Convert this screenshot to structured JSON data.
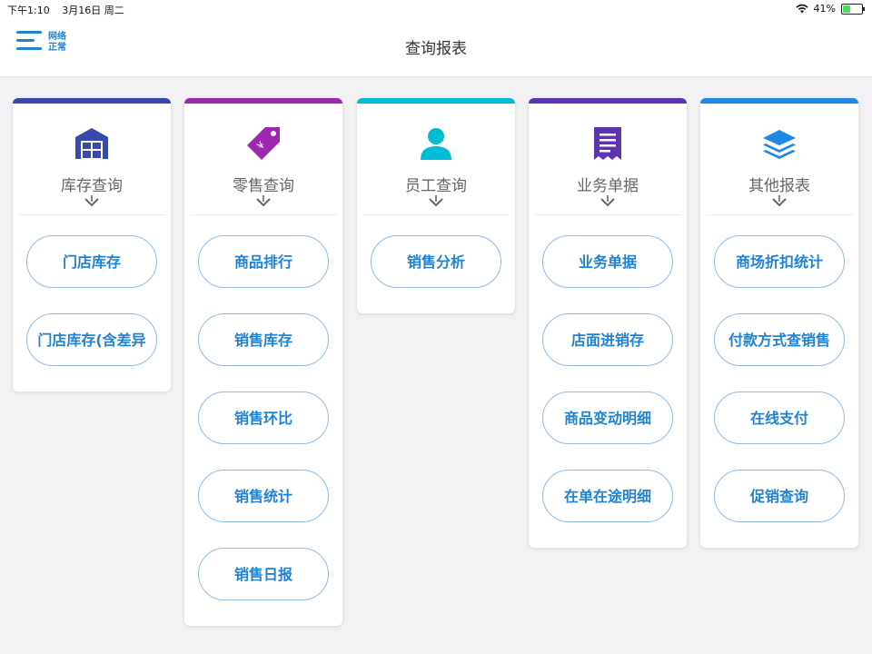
{
  "status_bar": {
    "time": "下午1:10",
    "date": "3月16日 周二",
    "battery": "41%",
    "battery_level": 0.41
  },
  "nav": {
    "title": "查询报表",
    "network_status": "网络正常"
  },
  "colors": {
    "accent": "#1f82d4"
  },
  "sections": [
    {
      "title": "库存查询",
      "color": "#3949ab",
      "icon": "warehouse-icon",
      "items": [
        "门店库存",
        "门店库存(含差异"
      ]
    },
    {
      "title": "零售查询",
      "color": "#9c27b0",
      "icon": "price-tag-icon",
      "items": [
        "商品排行",
        "销售库存",
        "销售环比",
        "销售统计",
        "销售日报"
      ]
    },
    {
      "title": "员工查询",
      "color": "#00bcd4",
      "icon": "user-icon",
      "items": [
        "销售分析"
      ]
    },
    {
      "title": "业务单据",
      "color": "#5e35b1",
      "icon": "receipt-icon",
      "items": [
        "业务单据",
        "店面进销存",
        "商品变动明细",
        "在单在途明细"
      ]
    },
    {
      "title": "其他报表",
      "color": "#1e88e5",
      "icon": "layers-icon",
      "items": [
        "商场折扣统计",
        "付款方式查销售",
        "在线支付",
        "促销查询"
      ]
    }
  ]
}
